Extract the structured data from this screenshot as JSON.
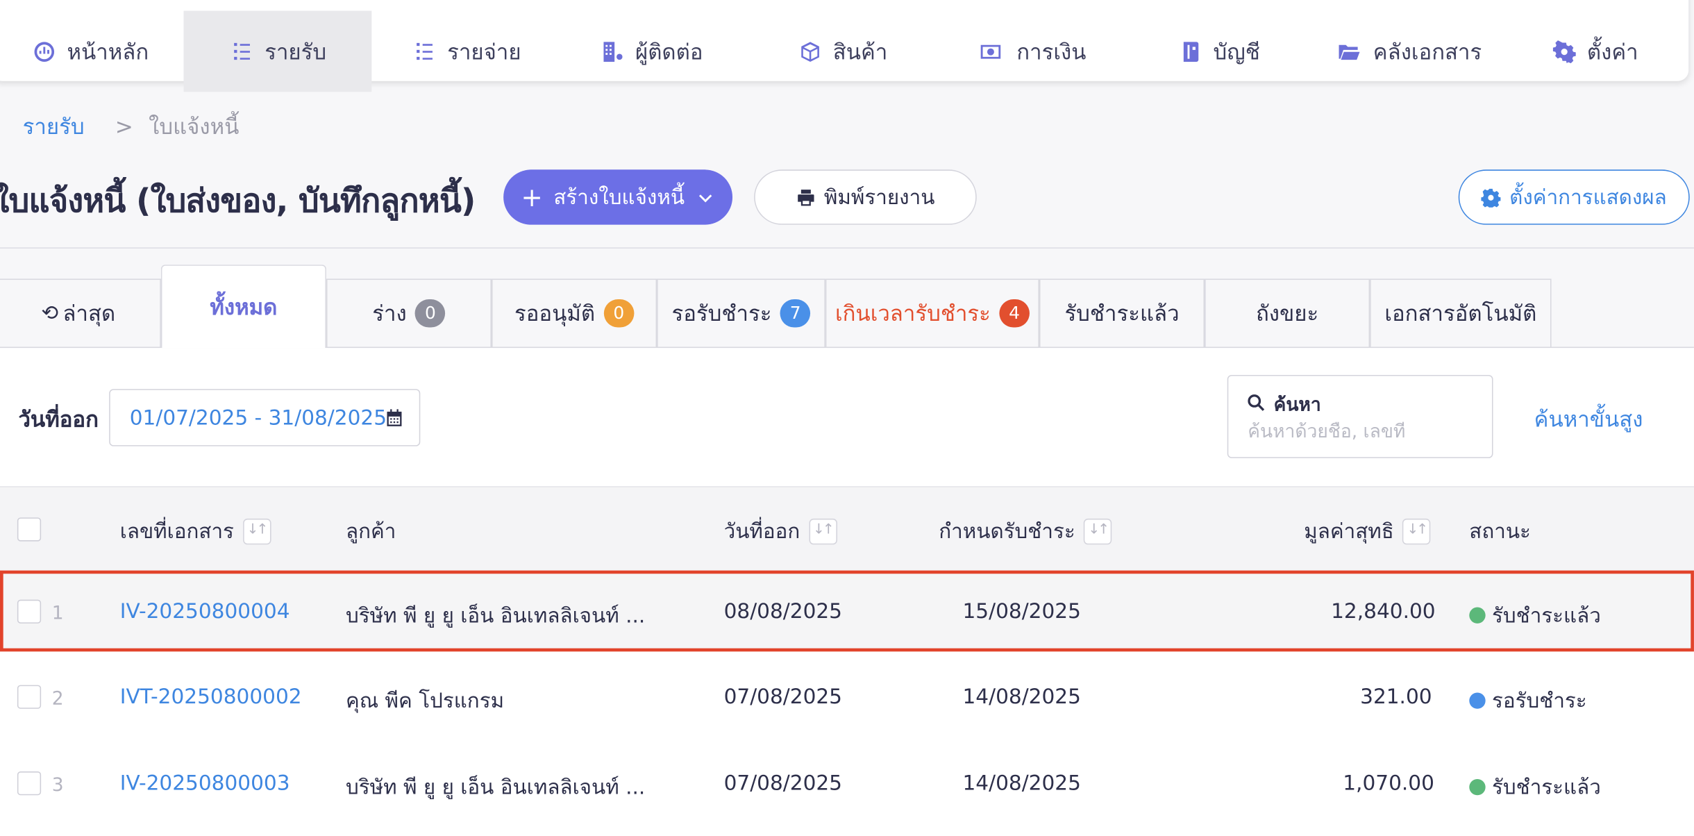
{
  "nav": {
    "items": [
      {
        "label": "หน้าหลัก",
        "icon": "dashboard-icon"
      },
      {
        "label": "รายรับ",
        "icon": "income-list-icon"
      },
      {
        "label": "รายจ่าย",
        "icon": "expense-list-icon"
      },
      {
        "label": "ผู้ติดต่อ",
        "icon": "contacts-building-icon"
      },
      {
        "label": "สินค้า",
        "icon": "product-box-icon"
      },
      {
        "label": "การเงิน",
        "icon": "money-icon"
      },
      {
        "label": "บัญชี",
        "icon": "ledger-book-icon"
      },
      {
        "label": "คลังเอกสาร",
        "icon": "folder-icon"
      },
      {
        "label": "ตั้งค่า",
        "icon": "gear-icon"
      }
    ],
    "active_index": 1
  },
  "breadcrumb": {
    "parent": "รายรับ",
    "separator": ">",
    "current": "ใบแจ้งหนี้"
  },
  "page": {
    "title": "ใบแจ้งหนี้ (ใบส่งของ, บันทึกลูกหนี้)",
    "create_label": "สร้างใบแจ้งหนี้",
    "print_label": "พิมพ์รายงาน",
    "display_settings_label": "ตั้งค่าการแสดงผล"
  },
  "tabs": [
    {
      "label": "ล่าสุด"
    },
    {
      "label": "ทั้งหมด",
      "active": true
    },
    {
      "label": "ร่าง",
      "badge": "0",
      "badge_color": "#8e8f9c"
    },
    {
      "label": "รออนุมัติ",
      "badge": "0",
      "badge_color": "#f0a038"
    },
    {
      "label": "รอรับชำระ",
      "badge": "7",
      "badge_color": "#4a90e8"
    },
    {
      "label": "เกินเวลารับชำระ",
      "badge": "4",
      "badge_color": "#e24f2e"
    },
    {
      "label": "รับชำระแล้ว"
    },
    {
      "label": "ถังขยะ"
    },
    {
      "label": "เอกสารอัตโนมัติ"
    }
  ],
  "filter": {
    "date_label": "วันที่ออก",
    "date_range": "01/07/2025 - 31/08/2025",
    "search_title": "ค้นหา",
    "search_placeholder": "ค้นหาด้วยชื่อ, เลขที่",
    "advanced_label": "ค้นหาขั้นสูง"
  },
  "table": {
    "headers": {
      "doc_no": "เลขที่เอกสาร",
      "customer": "ลูกค้า",
      "issue_date": "วันที่ออก",
      "due_date": "กำหนดรับชำระ",
      "net_amount": "มูลค่าสุทธิ",
      "status": "สถานะ"
    },
    "rows": [
      {
        "index": "1",
        "doc_no": "IV-20250800004",
        "customer": "บริษัท พี ยู ยู เอ็น อินเทลลิเจนท์ ...",
        "issue_date": "08/08/2025",
        "due_date": "15/08/2025",
        "net_amount": "12,840.00",
        "status": "รับชำระแล้ว",
        "status_color": "#5cb87a"
      },
      {
        "index": "2",
        "doc_no": "IVT-20250800002",
        "customer": "คุณ พีค โปรแกรม",
        "issue_date": "07/08/2025",
        "due_date": "14/08/2025",
        "net_amount": "321.00",
        "status": "รอรับชำระ",
        "status_color": "#4a90e8"
      },
      {
        "index": "3",
        "doc_no": "IV-20250800003",
        "customer": "บริษัท พี ยู ยู เอ็น อินเทลลิเจนท์ ...",
        "issue_date": "07/08/2025",
        "due_date": "14/08/2025",
        "net_amount": "1,070.00",
        "status": "รับชำระแล้ว",
        "status_color": "#5cb87a"
      }
    ],
    "highlighted_row": 1
  }
}
